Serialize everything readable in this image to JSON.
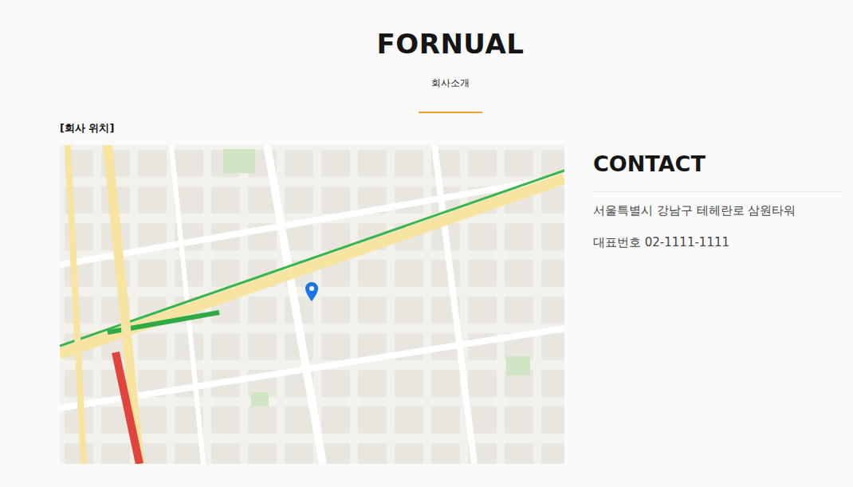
{
  "header": {
    "title": "FORNUAL",
    "subtitle": "회사소개"
  },
  "location": {
    "label": "[회사 위치]"
  },
  "contact": {
    "title": "CONTACT",
    "address": "서울특별시 강남구 테헤란로 삼원타워",
    "phone": "대표번호 02-1111-1111"
  }
}
